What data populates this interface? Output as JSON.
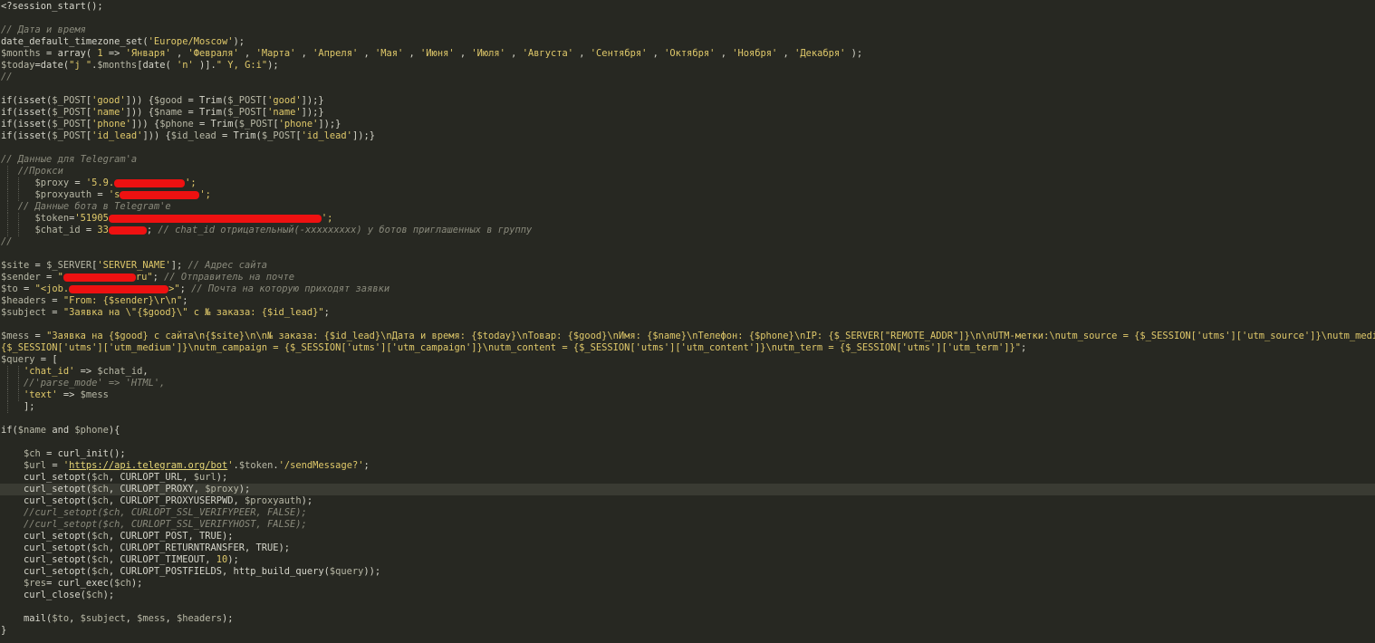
{
  "editor": {
    "lines": [
      [
        {
          "t": "<?",
          "c": "kw"
        },
        {
          "t": "session_start();",
          "c": "text"
        }
      ],
      [],
      [
        {
          "t": "// Дата и время",
          "c": "com"
        }
      ],
      [
        {
          "t": "date_default_timezone_set(",
          "c": "text"
        },
        {
          "t": "'Europe/Moscow'",
          "c": "str"
        },
        {
          "t": ");",
          "c": "text"
        }
      ],
      [
        {
          "t": "$months",
          "c": "var"
        },
        {
          "t": " = array( ",
          "c": "text"
        },
        {
          "t": "1",
          "c": "num"
        },
        {
          "t": " => ",
          "c": "text"
        },
        {
          "t": "'Января'",
          "c": "str"
        },
        {
          "t": " , ",
          "c": "text"
        },
        {
          "t": "'Февраля'",
          "c": "str"
        },
        {
          "t": " , ",
          "c": "text"
        },
        {
          "t": "'Марта'",
          "c": "str"
        },
        {
          "t": " , ",
          "c": "text"
        },
        {
          "t": "'Апреля'",
          "c": "str"
        },
        {
          "t": " , ",
          "c": "text"
        },
        {
          "t": "'Мая'",
          "c": "str"
        },
        {
          "t": " , ",
          "c": "text"
        },
        {
          "t": "'Июня'",
          "c": "str"
        },
        {
          "t": " , ",
          "c": "text"
        },
        {
          "t": "'Июля'",
          "c": "str"
        },
        {
          "t": " , ",
          "c": "text"
        },
        {
          "t": "'Августа'",
          "c": "str"
        },
        {
          "t": " , ",
          "c": "text"
        },
        {
          "t": "'Сентября'",
          "c": "str"
        },
        {
          "t": " , ",
          "c": "text"
        },
        {
          "t": "'Октября'",
          "c": "str"
        },
        {
          "t": " , ",
          "c": "text"
        },
        {
          "t": "'Ноября'",
          "c": "str"
        },
        {
          "t": " , ",
          "c": "text"
        },
        {
          "t": "'Декабря'",
          "c": "str"
        },
        {
          "t": " );",
          "c": "text"
        }
      ],
      [
        {
          "t": "$today",
          "c": "var"
        },
        {
          "t": "=date(",
          "c": "text"
        },
        {
          "t": "\"j \"",
          "c": "str"
        },
        {
          "t": ".",
          "c": "text"
        },
        {
          "t": "$months",
          "c": "var"
        },
        {
          "t": "[date( ",
          "c": "text"
        },
        {
          "t": "'n'",
          "c": "str"
        },
        {
          "t": " )].",
          "c": "text"
        },
        {
          "t": "\" Y, G:i\"",
          "c": "str"
        },
        {
          "t": ");",
          "c": "text"
        }
      ],
      [
        {
          "t": "//",
          "c": "com"
        }
      ],
      [],
      [
        {
          "t": "if(isset(",
          "c": "text"
        },
        {
          "t": "$_POST",
          "c": "var"
        },
        {
          "t": "[",
          "c": "text"
        },
        {
          "t": "'good'",
          "c": "str"
        },
        {
          "t": "])) {",
          "c": "text"
        },
        {
          "t": "$good",
          "c": "var"
        },
        {
          "t": " = Trim(",
          "c": "text"
        },
        {
          "t": "$_POST",
          "c": "var"
        },
        {
          "t": "[",
          "c": "text"
        },
        {
          "t": "'good'",
          "c": "str"
        },
        {
          "t": "]);}",
          "c": "text"
        }
      ],
      [
        {
          "t": "if(isset(",
          "c": "text"
        },
        {
          "t": "$_POST",
          "c": "var"
        },
        {
          "t": "[",
          "c": "text"
        },
        {
          "t": "'name'",
          "c": "str"
        },
        {
          "t": "])) {",
          "c": "text"
        },
        {
          "t": "$name",
          "c": "var"
        },
        {
          "t": " = Trim(",
          "c": "text"
        },
        {
          "t": "$_POST",
          "c": "var"
        },
        {
          "t": "[",
          "c": "text"
        },
        {
          "t": "'name'",
          "c": "str"
        },
        {
          "t": "]);}",
          "c": "text"
        }
      ],
      [
        {
          "t": "if(isset(",
          "c": "text"
        },
        {
          "t": "$_POST",
          "c": "var"
        },
        {
          "t": "[",
          "c": "text"
        },
        {
          "t": "'phone'",
          "c": "str"
        },
        {
          "t": "])) {",
          "c": "text"
        },
        {
          "t": "$phone",
          "c": "var"
        },
        {
          "t": " = Trim(",
          "c": "text"
        },
        {
          "t": "$_POST",
          "c": "var"
        },
        {
          "t": "[",
          "c": "text"
        },
        {
          "t": "'phone'",
          "c": "str"
        },
        {
          "t": "]);}",
          "c": "text"
        }
      ],
      [
        {
          "t": "if(isset(",
          "c": "text"
        },
        {
          "t": "$_POST",
          "c": "var"
        },
        {
          "t": "[",
          "c": "text"
        },
        {
          "t": "'id_lead'",
          "c": "str"
        },
        {
          "t": "])) {",
          "c": "text"
        },
        {
          "t": "$id_lead",
          "c": "var"
        },
        {
          "t": " = Trim(",
          "c": "text"
        },
        {
          "t": "$_POST",
          "c": "var"
        },
        {
          "t": "[",
          "c": "text"
        },
        {
          "t": "'id_lead'",
          "c": "str"
        },
        {
          "t": "]);}",
          "c": "text"
        }
      ],
      [],
      [
        {
          "t": "// Данные для Telegram'а",
          "c": "com"
        }
      ],
      [
        {
          "t": "   ",
          "c": "text"
        },
        {
          "t": "//Прокси",
          "c": "com"
        }
      ],
      [
        {
          "t": "      ",
          "c": "text"
        },
        {
          "t": "$proxy",
          "c": "var"
        },
        {
          "t": " = ",
          "c": "text"
        },
        {
          "t": "'5.9.",
          "c": "str"
        },
        {
          "r": 78
        },
        {
          "t": "';",
          "c": "str"
        }
      ],
      [
        {
          "t": "      ",
          "c": "text"
        },
        {
          "t": "$proxyauth",
          "c": "var"
        },
        {
          "t": " = ",
          "c": "text"
        },
        {
          "t": "'s",
          "c": "str"
        },
        {
          "r": 88
        },
        {
          "t": "';",
          "c": "str"
        }
      ],
      [
        {
          "t": "   ",
          "c": "text"
        },
        {
          "t": "// Данные бота в Telegram'е",
          "c": "com"
        }
      ],
      [
        {
          "t": "      ",
          "c": "text"
        },
        {
          "t": "$token",
          "c": "var"
        },
        {
          "t": "=",
          "c": "text"
        },
        {
          "t": "'51905",
          "c": "str"
        },
        {
          "r": 235
        },
        {
          "t": "';",
          "c": "str"
        }
      ],
      [
        {
          "t": "      ",
          "c": "text"
        },
        {
          "t": "$chat_id",
          "c": "var"
        },
        {
          "t": " = ",
          "c": "text"
        },
        {
          "t": "33",
          "c": "num"
        },
        {
          "r": 42
        },
        {
          "t": "; ",
          "c": "text"
        },
        {
          "t": "// chat_id отрицательный(-xxxxxxxxx) у ботов приглашенных в группу",
          "c": "com"
        }
      ],
      [
        {
          "t": "//",
          "c": "com"
        }
      ],
      [],
      [
        {
          "t": "$site",
          "c": "var"
        },
        {
          "t": " = ",
          "c": "text"
        },
        {
          "t": "$_SERVER",
          "c": "var"
        },
        {
          "t": "[",
          "c": "text"
        },
        {
          "t": "'SERVER_NAME'",
          "c": "str"
        },
        {
          "t": "]; ",
          "c": "text"
        },
        {
          "t": "// Адрес сайта",
          "c": "com"
        }
      ],
      [
        {
          "t": "$sender",
          "c": "var"
        },
        {
          "t": " = ",
          "c": "text"
        },
        {
          "t": "\"",
          "c": "str"
        },
        {
          "r": 80
        },
        {
          "t": "ru\"",
          "c": "str"
        },
        {
          "t": "; ",
          "c": "text"
        },
        {
          "t": "// Отправитель на почте",
          "c": "com"
        }
      ],
      [
        {
          "t": "$to",
          "c": "var"
        },
        {
          "t": " = ",
          "c": "text"
        },
        {
          "t": "\"<job.",
          "c": "str"
        },
        {
          "r": 110
        },
        {
          "t": ">\"",
          "c": "str"
        },
        {
          "t": "; ",
          "c": "text"
        },
        {
          "t": "// Почта на которую приходят заявки",
          "c": "com"
        }
      ],
      [
        {
          "t": "$headers",
          "c": "var"
        },
        {
          "t": " = ",
          "c": "text"
        },
        {
          "t": "\"From: {$sender}\\r\\n\"",
          "c": "str"
        },
        {
          "t": ";",
          "c": "text"
        }
      ],
      [
        {
          "t": "$subject",
          "c": "var"
        },
        {
          "t": " = ",
          "c": "text"
        },
        {
          "t": "\"Заявка на \\\"{$good}\\\" с № заказа: {$id_lead}\"",
          "c": "str"
        },
        {
          "t": ";",
          "c": "text"
        }
      ],
      [],
      [
        {
          "t": "$mess",
          "c": "var"
        },
        {
          "t": " = ",
          "c": "text"
        },
        {
          "t": "\"Заявка на {$good} с сайта\\n{$site}\\n\\n№ заказа: {$id_lead}\\nДата и время: {$today}\\nТовар: {$good}\\nИмя: {$name}\\nТелефон: {$phone}\\nIP: {$_SERVER[\"REMOTE_ADDR\"]}\\n\\nUTM-метки:\\nutm_source = {$_SESSION['utms']['utm_source']}\\nutm_medium =",
          "c": "str"
        }
      ],
      [
        {
          "t": "{$_SESSION['utms']['utm_medium']}\\nutm_campaign = {$_SESSION['utms']['utm_campaign']}\\nutm_content = {$_SESSION['utms']['utm_content']}\\nutm_term = {$_SESSION['utms']['utm_term']}\"",
          "c": "str"
        },
        {
          "t": ";",
          "c": "text"
        }
      ],
      [
        {
          "t": "$query",
          "c": "var"
        },
        {
          "t": " = [",
          "c": "text"
        }
      ],
      [
        {
          "t": "    ",
          "c": "text"
        },
        {
          "t": "'chat_id'",
          "c": "str"
        },
        {
          "t": " => ",
          "c": "text"
        },
        {
          "t": "$chat_id",
          "c": "var"
        },
        {
          "t": ",",
          "c": "text"
        }
      ],
      [
        {
          "t": "    ",
          "c": "text"
        },
        {
          "t": "//'parse_mode' => 'HTML',",
          "c": "com"
        }
      ],
      [
        {
          "t": "    ",
          "c": "text"
        },
        {
          "t": "'text'",
          "c": "str"
        },
        {
          "t": " => ",
          "c": "text"
        },
        {
          "t": "$mess",
          "c": "var"
        }
      ],
      [
        {
          "t": "    ];",
          "c": "text"
        }
      ],
      [],
      [
        {
          "t": "if(",
          "c": "text"
        },
        {
          "t": "$name",
          "c": "var"
        },
        {
          "t": " and ",
          "c": "text"
        },
        {
          "t": "$phone",
          "c": "var"
        },
        {
          "t": "){",
          "c": "text"
        }
      ],
      [],
      [
        {
          "t": "    ",
          "c": "text"
        },
        {
          "t": "$ch",
          "c": "var"
        },
        {
          "t": " = curl_init();",
          "c": "text"
        }
      ],
      [
        {
          "t": "    ",
          "c": "text"
        },
        {
          "t": "$url",
          "c": "var"
        },
        {
          "t": " = ",
          "c": "text"
        },
        {
          "t": "'",
          "c": "str"
        },
        {
          "t": "https://api.telegram.org/bot",
          "c": "url"
        },
        {
          "t": "'",
          "c": "str"
        },
        {
          "t": ".",
          "c": "text"
        },
        {
          "t": "$token",
          "c": "var"
        },
        {
          "t": ".",
          "c": "text"
        },
        {
          "t": "'/sendMessage?'",
          "c": "str"
        },
        {
          "t": ";",
          "c": "text"
        }
      ],
      [
        {
          "t": "    curl_setopt(",
          "c": "text"
        },
        {
          "t": "$ch",
          "c": "var"
        },
        {
          "t": ", CURLOPT_URL, ",
          "c": "text"
        },
        {
          "t": "$url",
          "c": "var"
        },
        {
          "t": ");",
          "c": "text"
        }
      ],
      [
        {
          "t": "    curl_setopt(",
          "c": "text"
        },
        {
          "t": "$ch",
          "c": "var"
        },
        {
          "t": ", CURLOPT_PROXY, ",
          "c": "text"
        },
        {
          "t": "$proxy",
          "c": "var"
        },
        {
          "t": ");",
          "c": "text"
        }
      ],
      [
        {
          "t": "    curl_setopt(",
          "c": "text"
        },
        {
          "t": "$ch",
          "c": "var"
        },
        {
          "t": ", CURLOPT_PROXYUSERPWD, ",
          "c": "text"
        },
        {
          "t": "$proxyauth",
          "c": "var"
        },
        {
          "t": ");",
          "c": "text"
        }
      ],
      [
        {
          "t": "    ",
          "c": "text"
        },
        {
          "t": "//curl_setopt($ch, CURLOPT_SSL_VERIFYPEER, FALSE);",
          "c": "com"
        }
      ],
      [
        {
          "t": "    ",
          "c": "text"
        },
        {
          "t": "//curl_setopt($ch, CURLOPT_SSL_VERIFYHOST, FALSE);",
          "c": "com"
        }
      ],
      [
        {
          "t": "    curl_setopt(",
          "c": "text"
        },
        {
          "t": "$ch",
          "c": "var"
        },
        {
          "t": ", CURLOPT_POST, TRUE);",
          "c": "text"
        }
      ],
      [
        {
          "t": "    curl_setopt(",
          "c": "text"
        },
        {
          "t": "$ch",
          "c": "var"
        },
        {
          "t": ", CURLOPT_RETURNTRANSFER, TRUE);",
          "c": "text"
        }
      ],
      [
        {
          "t": "    curl_setopt(",
          "c": "text"
        },
        {
          "t": "$ch",
          "c": "var"
        },
        {
          "t": ", CURLOPT_TIMEOUT, ",
          "c": "text"
        },
        {
          "t": "10",
          "c": "num"
        },
        {
          "t": ");",
          "c": "text"
        }
      ],
      [
        {
          "t": "    curl_setopt(",
          "c": "text"
        },
        {
          "t": "$ch",
          "c": "var"
        },
        {
          "t": ", CURLOPT_POSTFIELDS, http_build_query(",
          "c": "text"
        },
        {
          "t": "$query",
          "c": "var"
        },
        {
          "t": "));",
          "c": "text"
        }
      ],
      [
        {
          "t": "    ",
          "c": "text"
        },
        {
          "t": "$res",
          "c": "var"
        },
        {
          "t": "= curl_exec(",
          "c": "text"
        },
        {
          "t": "$ch",
          "c": "var"
        },
        {
          "t": ");",
          "c": "text"
        }
      ],
      [
        {
          "t": "    curl_close(",
          "c": "text"
        },
        {
          "t": "$ch",
          "c": "var"
        },
        {
          "t": ");",
          "c": "text"
        }
      ],
      [],
      [
        {
          "t": "    mail(",
          "c": "text"
        },
        {
          "t": "$to",
          "c": "var"
        },
        {
          "t": ", ",
          "c": "text"
        },
        {
          "t": "$subject",
          "c": "var"
        },
        {
          "t": ", ",
          "c": "text"
        },
        {
          "t": "$mess",
          "c": "var"
        },
        {
          "t": ", ",
          "c": "text"
        },
        {
          "t": "$headers",
          "c": "var"
        },
        {
          "t": ");",
          "c": "text"
        }
      ],
      [
        {
          "t": "}",
          "c": "text"
        }
      ]
    ],
    "current_line": 41,
    "colors": {
      "background": "#272822",
      "current_line": "#3a3b33",
      "text": "#d6d6cb",
      "string": "#e0c96a",
      "comment": "#8a8a7c",
      "redaction": "#ee1111"
    }
  }
}
